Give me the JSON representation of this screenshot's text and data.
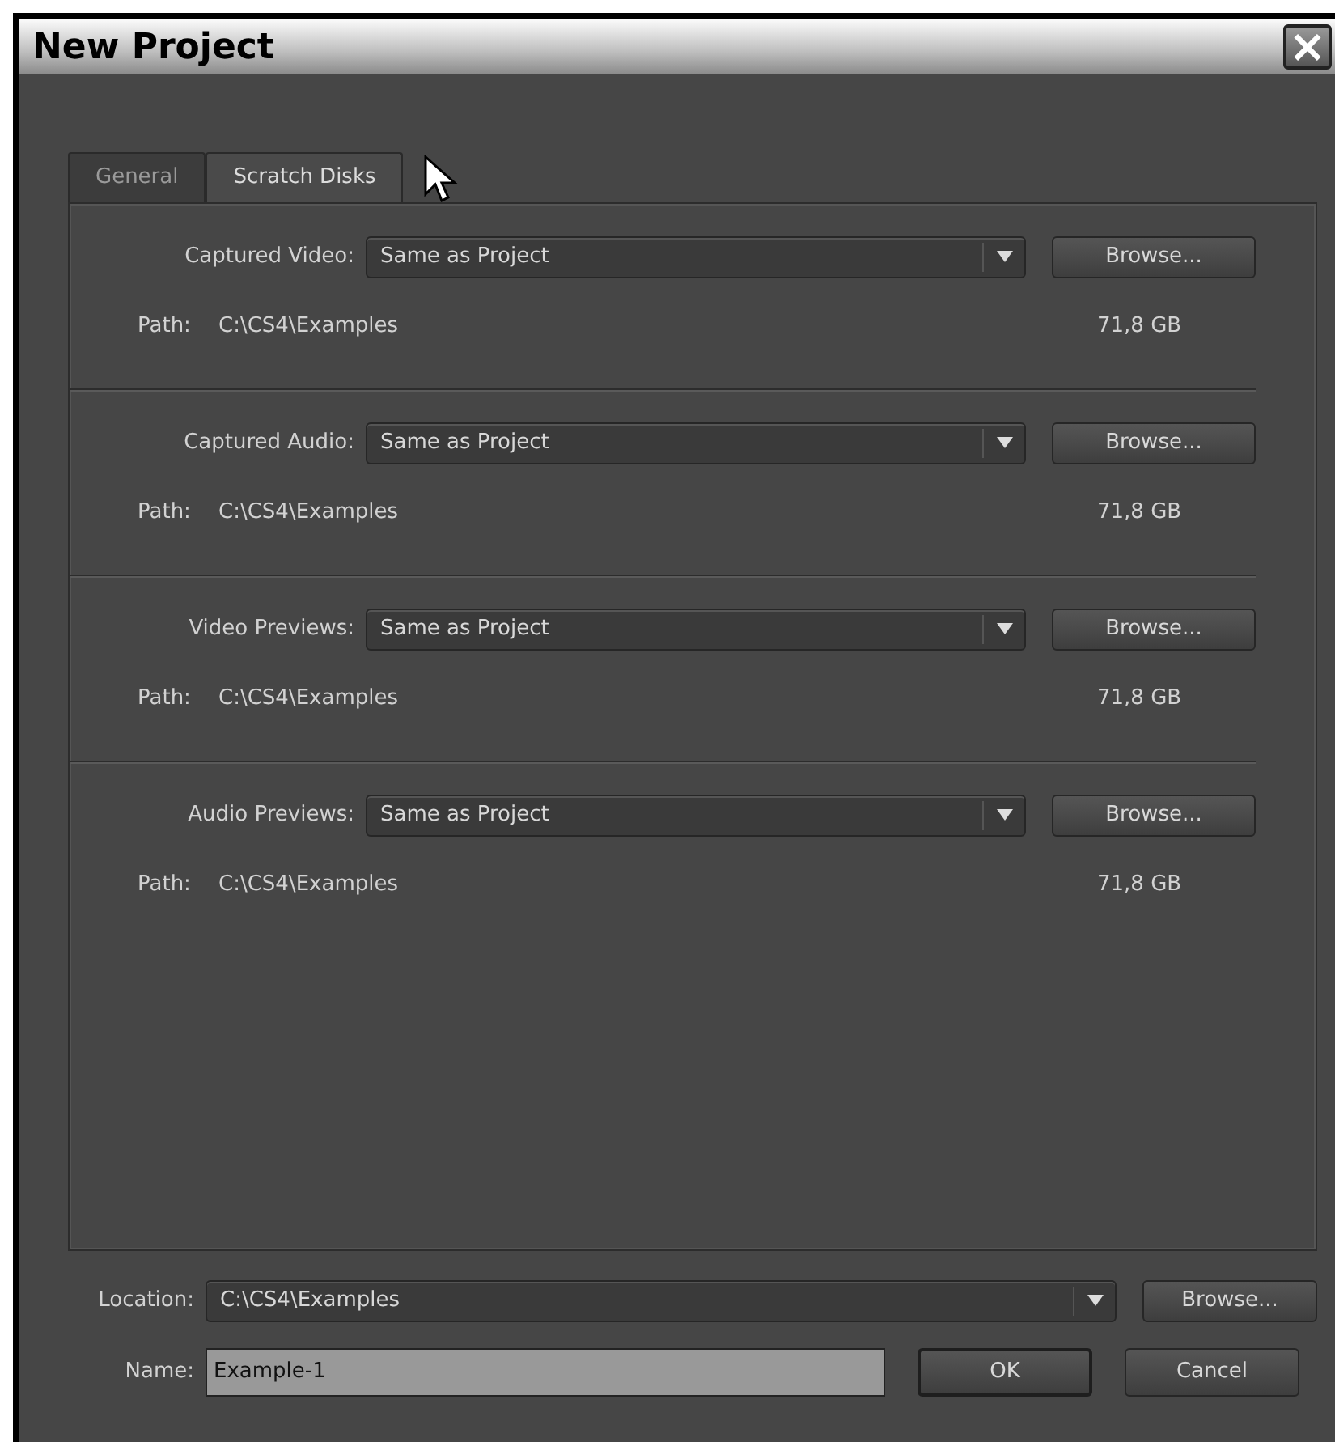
{
  "window": {
    "title": "New Project",
    "close": "×"
  },
  "tabs": [
    {
      "label": "General",
      "selected": false
    },
    {
      "label": "Scratch Disks",
      "selected": true
    }
  ],
  "disks": [
    {
      "label": "Captured Video:",
      "value": "Same as Project",
      "button": "Browse...",
      "path_label": "Path:",
      "path": "C:\\CS4\\Examples",
      "size": "71,8 GB"
    },
    {
      "label": "Captured Audio:",
      "value": "Same as Project",
      "button": "Browse...",
      "path_label": "Path:",
      "path": "C:\\CS4\\Examples",
      "size": "71,8 GB"
    },
    {
      "label": "Video Previews:",
      "value": "Same as Project",
      "button": "Browse...",
      "path_label": "Path:",
      "path": "C:\\CS4\\Examples",
      "size": "71,8 GB"
    },
    {
      "label": "Audio Previews:",
      "value": "Same as Project",
      "button": "Browse...",
      "path_label": "Path:",
      "path": "C:\\CS4\\Examples",
      "size": "71,8 GB"
    }
  ],
  "location": {
    "label": "Location:",
    "value": "C:\\CS4\\Examples",
    "button": "Browse..."
  },
  "name": {
    "label": "Name:",
    "value": "Example-1"
  },
  "buttons": [
    "OK",
    "Cancel"
  ]
}
